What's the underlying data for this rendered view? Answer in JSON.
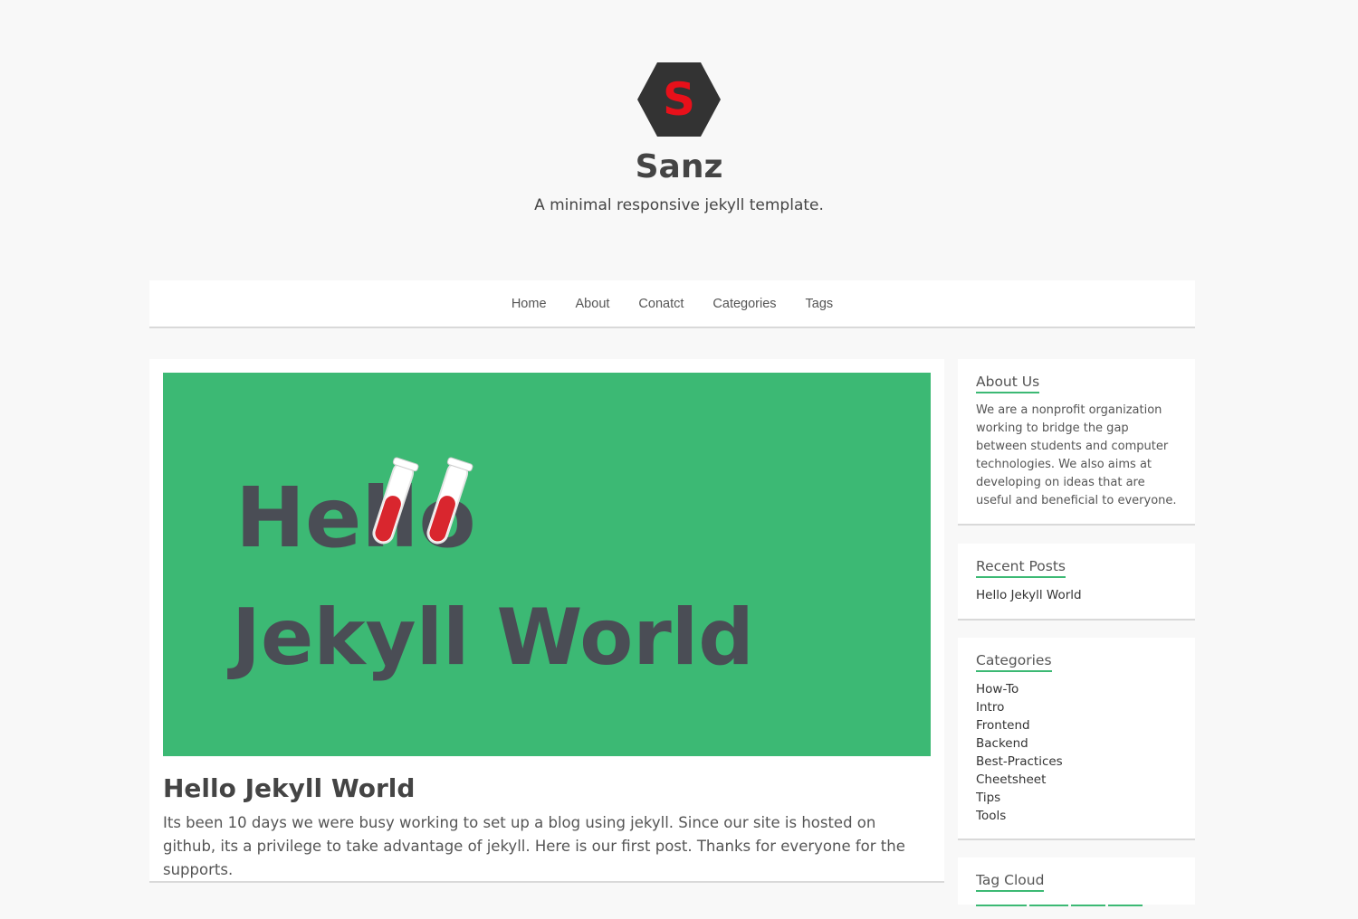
{
  "site": {
    "logo_letter": "S",
    "title": "Sanz",
    "tagline": "A minimal responsive jekyll template."
  },
  "nav": {
    "items": [
      {
        "label": "Home"
      },
      {
        "label": "About"
      },
      {
        "label": "Conatct"
      },
      {
        "label": "Categories"
      },
      {
        "label": "Tags"
      }
    ]
  },
  "post": {
    "image_text_line1": "Hello",
    "image_text_line2": "Jekyll World",
    "title": "Hello Jekyll World",
    "excerpt": "Its been 10 days we were busy working to set up a blog using jekyll. Since our site is hosted on github, its a privilege to take advantage of jekyll. Here is our first post. Thanks for everyone for the supports."
  },
  "sidebar": {
    "about": {
      "title": "About Us",
      "text": "We are a nonprofit organization working to bridge the gap between students and computer technologies. We also aims at developing on ideas that are useful and beneficial to everyone."
    },
    "recent": {
      "title": "Recent Posts",
      "items": [
        {
          "label": "Hello Jekyll World"
        }
      ]
    },
    "categories": {
      "title": "Categories",
      "items": [
        {
          "label": "How-To"
        },
        {
          "label": "Intro"
        },
        {
          "label": "Frontend"
        },
        {
          "label": "Backend"
        },
        {
          "label": "Best-Practices"
        },
        {
          "label": "Cheetsheet"
        },
        {
          "label": "Tips"
        },
        {
          "label": "Tools"
        }
      ]
    },
    "tagcloud": {
      "title": "Tag Cloud"
    }
  },
  "colors": {
    "accent": "#3cb974",
    "logo_bg": "#333333",
    "logo_letter": "#e8101a",
    "image_text": "#4a4d55",
    "tube_liquid": "#d9262e"
  }
}
